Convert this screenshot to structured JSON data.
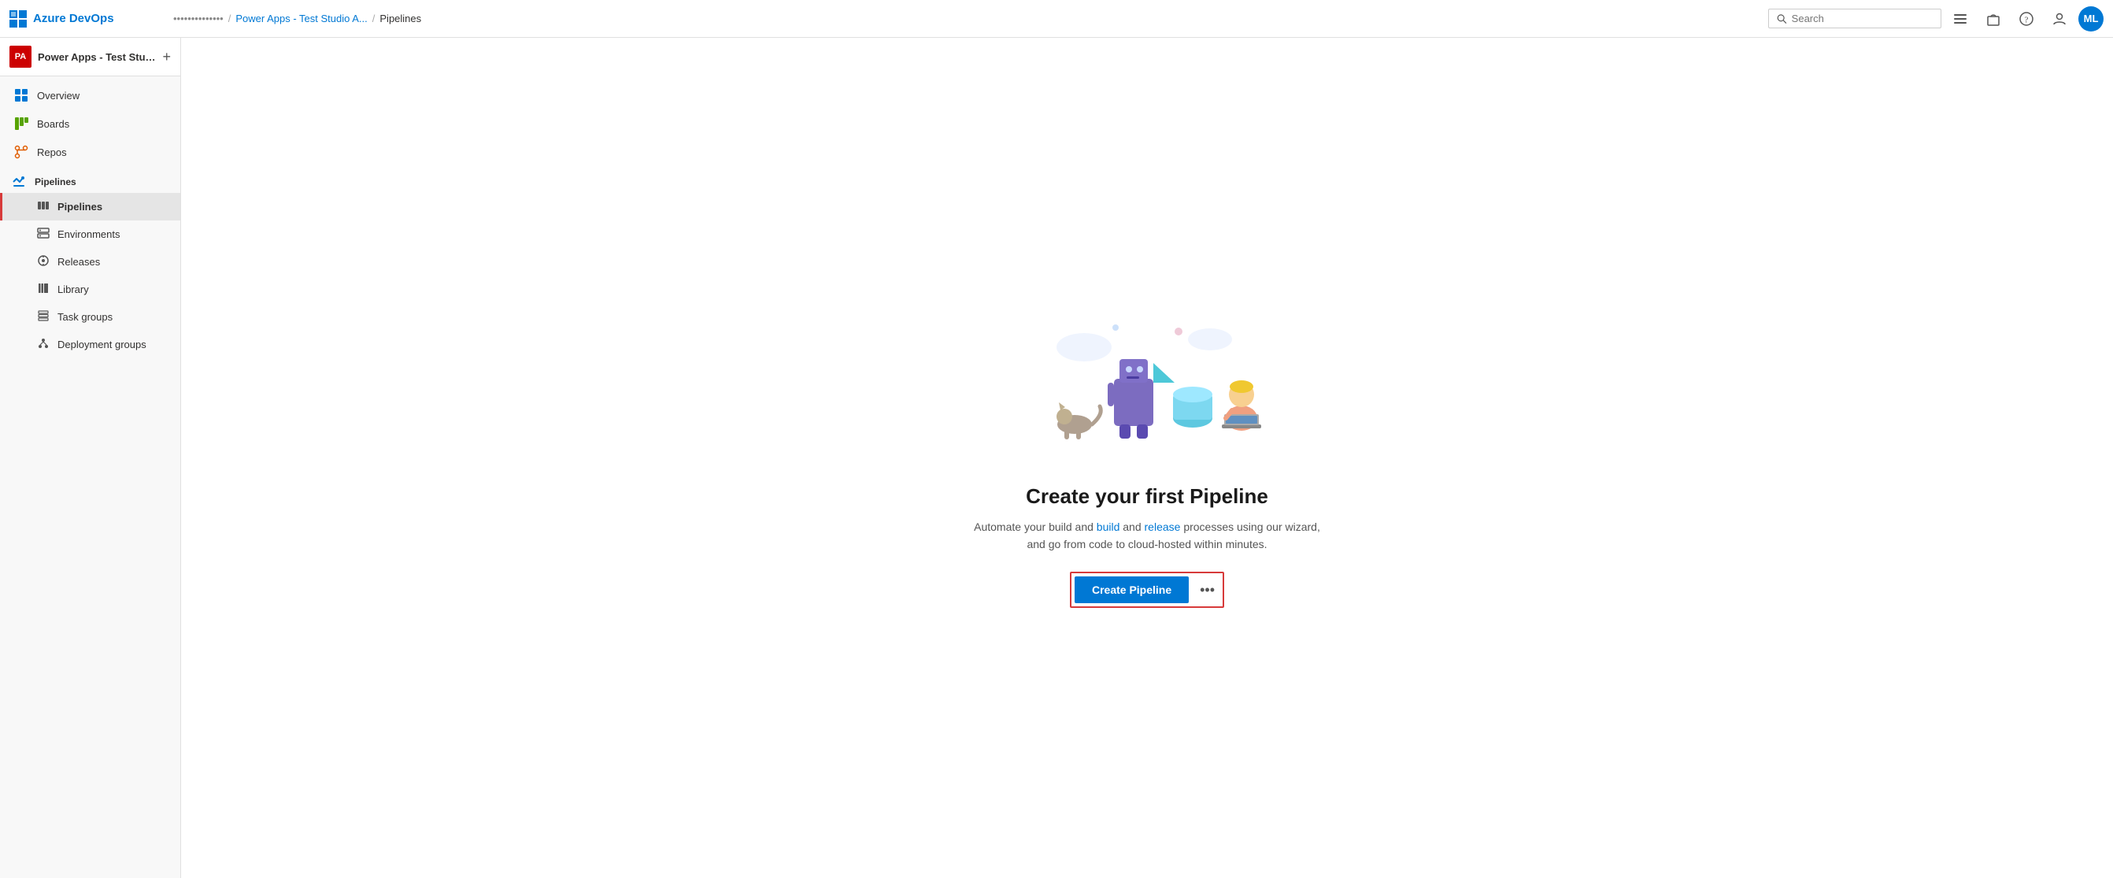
{
  "app": {
    "name": "Azure DevOps",
    "logo_label": "Azure DevOps logo"
  },
  "topbar": {
    "org_name": "••••••••••••••",
    "project_name": "Power Apps - Test Studio A...",
    "current_page": "Pipelines",
    "search_placeholder": "Search",
    "search_label": "Search"
  },
  "sidebar": {
    "project_initials": "PA",
    "project_name": "Power Apps - Test Stud...",
    "add_button_label": "+",
    "nav_items": [
      {
        "id": "overview",
        "label": "Overview",
        "icon": "overview-icon"
      },
      {
        "id": "boards",
        "label": "Boards",
        "icon": "boards-icon"
      },
      {
        "id": "repos",
        "label": "Repos",
        "icon": "repos-icon"
      },
      {
        "id": "pipelines",
        "label": "Pipelines",
        "icon": "pipelines-icon"
      }
    ],
    "sub_items": [
      {
        "id": "pipelines-sub",
        "label": "Pipelines",
        "active": true
      },
      {
        "id": "environments",
        "label": "Environments"
      },
      {
        "id": "releases",
        "label": "Releases"
      },
      {
        "id": "library",
        "label": "Library"
      },
      {
        "id": "task-groups",
        "label": "Task groups"
      },
      {
        "id": "deployment-groups",
        "label": "Deployment groups"
      }
    ]
  },
  "main": {
    "title": "Create your first Pipeline",
    "subtitle_part1": "Automate your build and ",
    "subtitle_link1": "build",
    "subtitle_part2": " and ",
    "subtitle_link2": "release",
    "subtitle_part3": " processes using our wizard, and go from\ncode to cloud-hosted within minutes.",
    "subtitle_full": "Automate your build and release processes using our wizard, and go from code to cloud-hosted within minutes.",
    "create_button": "Create Pipeline",
    "more_button_label": "•••",
    "avatar_initials": "ML"
  }
}
